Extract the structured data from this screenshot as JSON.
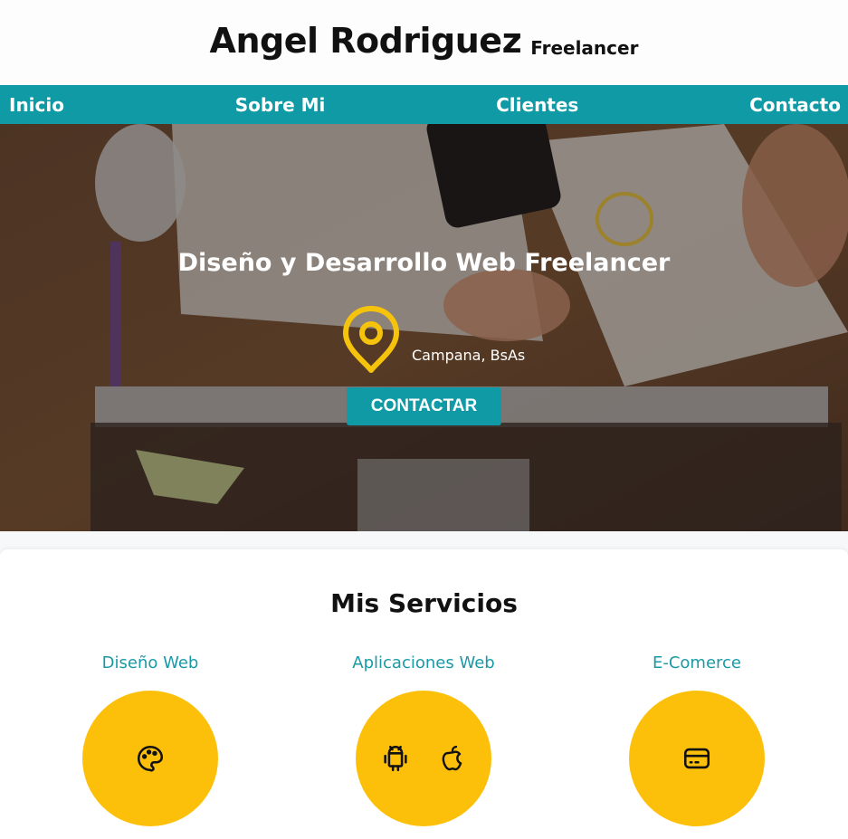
{
  "header": {
    "name": "Angel Rodriguez",
    "role": "Freelancer"
  },
  "nav": {
    "items": [
      "Inicio",
      "Sobre Mi",
      "Clientes",
      "Contacto"
    ]
  },
  "hero": {
    "title": "Diseño y Desarrollo Web Freelancer",
    "location": "Campana, BsAs",
    "cta": "CONTACTAR",
    "pin_color": "#f5c30b"
  },
  "services": {
    "heading": "Mis Servicios",
    "items": [
      {
        "title": "Diseño Web",
        "icon": "palette-icon"
      },
      {
        "title": "Aplicaciones Web",
        "icons": [
          "android-icon",
          "apple-icon"
        ]
      },
      {
        "title": "E-Comerce",
        "icon": "credit-card-icon"
      }
    ]
  },
  "colors": {
    "accent": "#0f9aa6",
    "yellow": "#fdc00a"
  }
}
